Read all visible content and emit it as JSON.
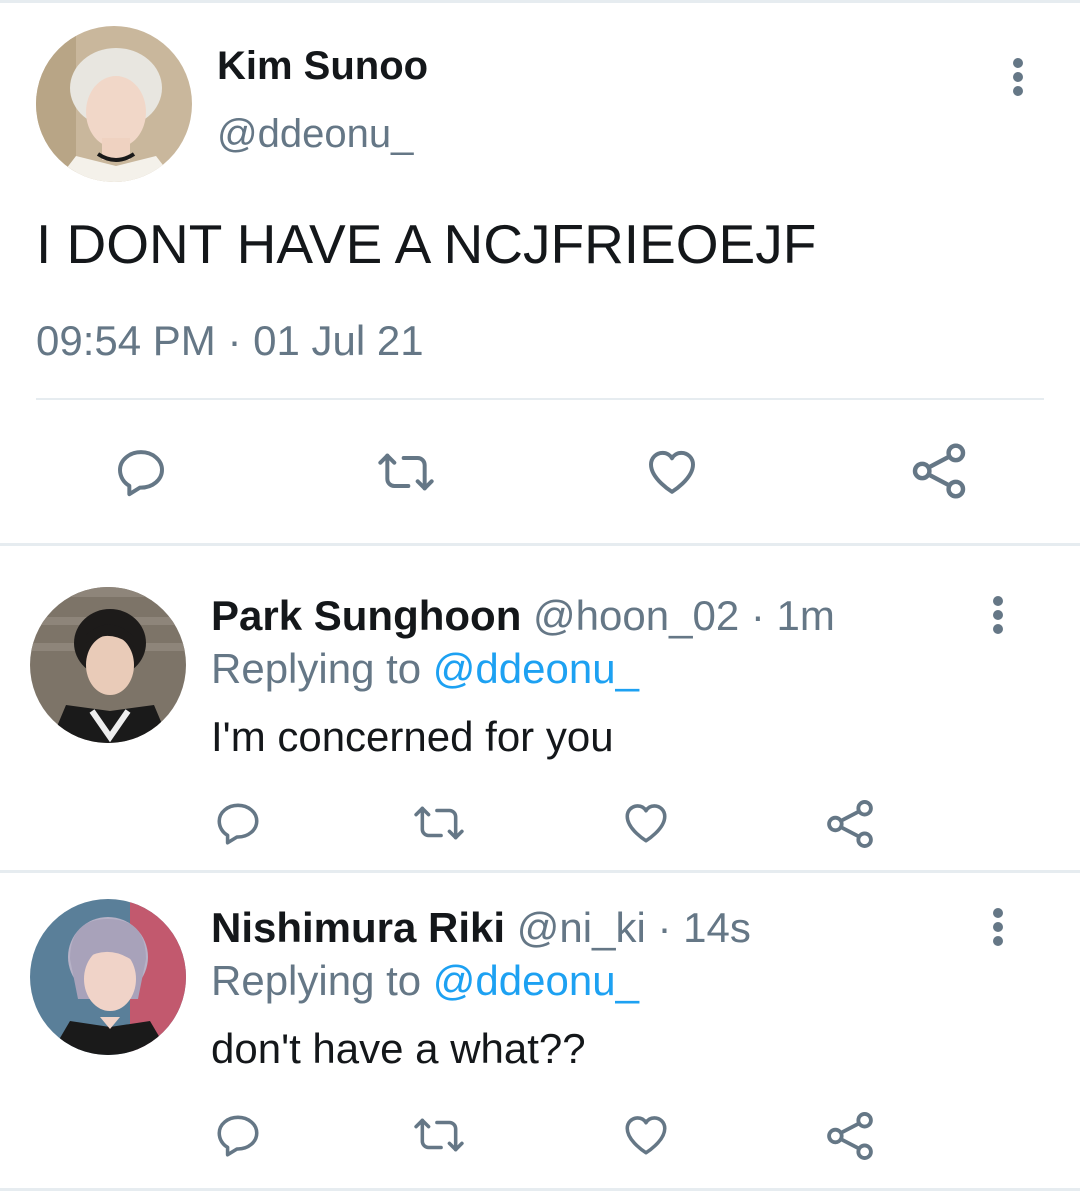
{
  "main_tweet": {
    "display_name": "Kim Sunoo",
    "handle": "@ddeonu_",
    "text": "I DONT HAVE A NCJFRIEOEJF",
    "timestamp": "09:54 PM · 01 Jul 21"
  },
  "replies": [
    {
      "display_name": "Park Sunghoon",
      "handle": "@hoon_02",
      "time": "· 1m",
      "replying_label": "Replying to",
      "replying_to": "@ddeonu_",
      "text": "I'm concerned for you"
    },
    {
      "display_name": "Nishimura Riki",
      "handle": "@ni_ki",
      "time": "· 14s",
      "replying_label": "Replying to",
      "replying_to": "@ddeonu_",
      "text": "don't have a what??"
    }
  ],
  "icons": {
    "reply": "reply-icon",
    "retweet": "retweet-icon",
    "like": "heart-icon",
    "share": "share-icon",
    "more": "more-vertical-icon"
  },
  "colors": {
    "text": "#14171a",
    "muted": "#657786",
    "link": "#1da1f2",
    "divider": "#e6ecf0"
  }
}
